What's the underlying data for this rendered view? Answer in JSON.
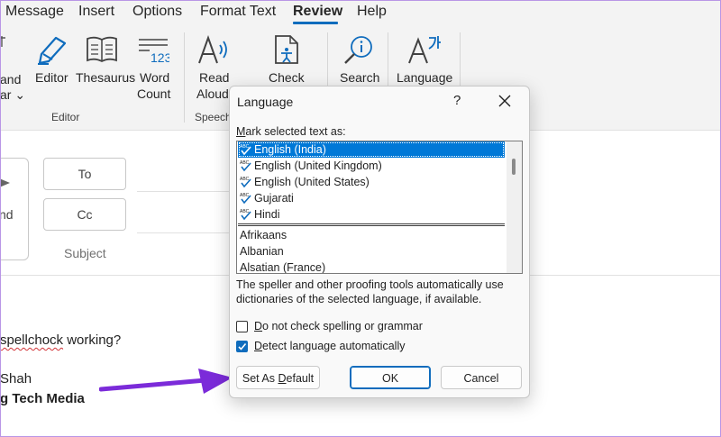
{
  "menu": {
    "tabs": [
      {
        "label": "Message"
      },
      {
        "label": "Insert"
      },
      {
        "label": "Options"
      },
      {
        "label": "Format Text"
      },
      {
        "label": "Review"
      },
      {
        "label": "Help"
      }
    ],
    "active": "Review"
  },
  "ribbon": {
    "partial_left": {
      "line1": "and",
      "line2": "ar"
    },
    "buttons": {
      "editor": "Editor",
      "thesaurus": "Thesaurus",
      "word_count_1": "Word",
      "word_count_2": "Count",
      "read_aloud_1": "Read",
      "read_aloud_2": "Aloud",
      "check": "Check",
      "search": "Search",
      "language": "Language"
    },
    "groups": {
      "editor": "Editor",
      "speech": "Speech"
    }
  },
  "compose": {
    "send_partial": "nd",
    "to_label": "To",
    "cc_label": "Cc",
    "subject_label": "Subject",
    "body": {
      "line1_plain": "",
      "line1_error": "spellchock",
      "line1_rest": " working?",
      "signature_name": "Shah",
      "signature_org": "g Tech Media"
    }
  },
  "dialog": {
    "title": "Language",
    "help": "?",
    "mark_label_prefix": "M",
    "mark_label_rest": "ark selected text as:",
    "languages_recent": [
      {
        "name": "English (India)",
        "selected": true
      },
      {
        "name": "English (United Kingdom)",
        "selected": false
      },
      {
        "name": "English (United States)",
        "selected": false
      },
      {
        "name": "Gujarati",
        "selected": false
      },
      {
        "name": "Hindi",
        "selected": false
      }
    ],
    "languages_all": [
      {
        "name": "Afrikaans"
      },
      {
        "name": "Albanian"
      },
      {
        "name": "Alsatian (France)"
      }
    ],
    "note": "The speller and other proofing tools automatically use dictionaries of the selected language, if available.",
    "checkbox_no_check": {
      "prefix": "",
      "accel": "D",
      "rest": "o not check spelling or grammar",
      "checked": false
    },
    "checkbox_detect": {
      "prefix": "",
      "accel": "D",
      "rest": "etect language automatically",
      "checked": true
    },
    "buttons": {
      "set_default_prefix": "Set As ",
      "set_default_accel": "D",
      "set_default_rest": "efault",
      "ok": "OK",
      "cancel": "Cancel"
    }
  },
  "colors": {
    "accent": "#0f6cbd",
    "selection": "#0078d7",
    "arrow": "#7b2bd9"
  }
}
